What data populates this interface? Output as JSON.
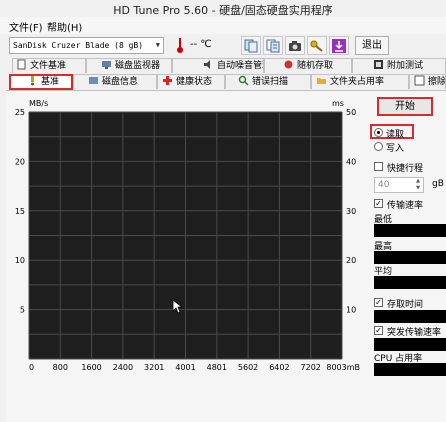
{
  "window": {
    "title": "HD Tune Pro 5.60 - 硬盘/固态硬盘实用程序"
  },
  "menu": {
    "file": "文件(F)",
    "help": "帮助(H)"
  },
  "toolbar": {
    "drive": "SanDisk Cruzer Blade (8 gB)",
    "temperature": "-- ℃",
    "exit_label": "退出",
    "icons": [
      "copy-info-icon",
      "copy-text-icon",
      "camera-icon",
      "key-icon",
      "download-icon"
    ]
  },
  "tabs": {
    "row1": [
      {
        "label": "文件基准",
        "icon": "file-icon"
      },
      {
        "label": "磁盘监视器",
        "icon": "monitor-icon"
      },
      {
        "label": "自动噪音管理",
        "icon": "speaker-icon"
      },
      {
        "label": "随机存取",
        "icon": "random-icon"
      },
      {
        "label": "附加测试",
        "icon": "extra-icon"
      }
    ],
    "row2": [
      {
        "label": "基准",
        "icon": "benchmark-icon",
        "active": true
      },
      {
        "label": "磁盘信息",
        "icon": "info-icon"
      },
      {
        "label": "健康状态",
        "icon": "health-icon"
      },
      {
        "label": "错误扫描",
        "icon": "scan-icon"
      },
      {
        "label": "文件夹占用率",
        "icon": "folder-icon"
      },
      {
        "label": "擦除",
        "icon": "erase-icon"
      }
    ]
  },
  "controls": {
    "start_label": "开始",
    "read_label": "读取",
    "write_label": "写入",
    "short_stroke_label": "快捷行程",
    "short_stroke_value": "40",
    "short_stroke_unit": "gB",
    "transfer_rate_label": "传输速率",
    "min_label": "最低",
    "max_label": "最高",
    "avg_label": "平均",
    "access_time_label": "存取时间",
    "burst_rate_label": "突发传输速率",
    "cpu_label": "CPU 占用率"
  },
  "chart_data": {
    "type": "line",
    "y_left_label": "MB/s",
    "y_right_label": "ms",
    "y_left_ticks": [
      25,
      20,
      15,
      10,
      5
    ],
    "y_right_ticks": [
      50,
      40,
      30,
      20,
      10
    ],
    "x_ticks": [
      "0",
      "800",
      "1600",
      "2400",
      "3201",
      "4001",
      "4801",
      "5602",
      "6402",
      "7202",
      "8003mB"
    ],
    "ylim_left": [
      0,
      25
    ],
    "ylim_right": [
      0,
      50
    ],
    "xlim": [
      0,
      8003
    ],
    "grid": true,
    "background": "#1e1e1e",
    "series": []
  }
}
